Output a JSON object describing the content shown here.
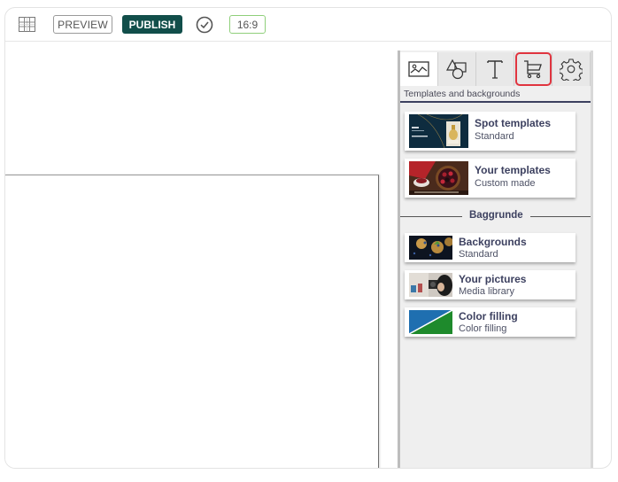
{
  "toolbar": {
    "grid_icon": "grid-icon",
    "preview_label": "PREVIEW",
    "publish_label": "PUBLISH",
    "check_icon": "check-circle-icon",
    "aspect_ratio_label": "16:9",
    "colors": {
      "publish_bg": "#114e4a",
      "ratio_border": "#8fcf7a"
    }
  },
  "panel": {
    "tabs": [
      {
        "icon": "image-icon",
        "active": true
      },
      {
        "icon": "shapes-icon",
        "active": false
      },
      {
        "icon": "text-icon",
        "active": false
      },
      {
        "icon": "cart-icon",
        "active": false,
        "highlighted": true
      },
      {
        "icon": "gear-icon",
        "active": false
      }
    ],
    "caption": "Templates and backgrounds",
    "templates": [
      {
        "title": "Spot templates",
        "subtitle": "Standard"
      },
      {
        "title": "Your templates",
        "subtitle": "Custom made"
      }
    ],
    "section_label": "Baggrunde",
    "backgrounds": [
      {
        "title": "Backgrounds",
        "subtitle": "Standard"
      },
      {
        "title": "Your pictures",
        "subtitle": "Media library"
      },
      {
        "title": "Color filling",
        "subtitle": "Color filling"
      }
    ],
    "highlight_color": "#e0343f"
  }
}
